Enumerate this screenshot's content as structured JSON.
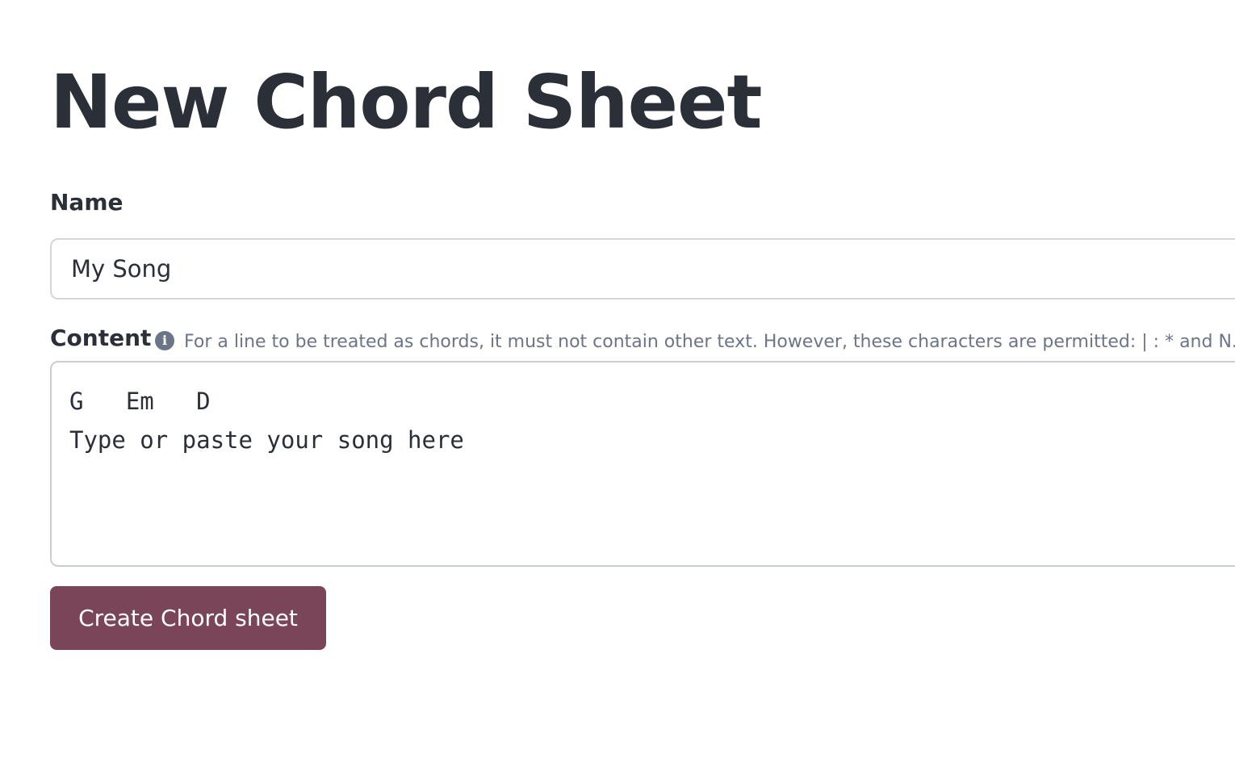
{
  "page_title": "New Chord Sheet",
  "form": {
    "name_label": "Name",
    "name_value": "My Song",
    "content_label": "Content",
    "info_icon": "info-circle-icon",
    "content_hint": "For a line to be treated as chords, it must not contain other text. However, these characters are permitted: | : * and N.C.",
    "content_value": "G   Em   D\nType or paste your song here",
    "submit_label": "Create Chord sheet",
    "accent_color": "#7a4559"
  }
}
